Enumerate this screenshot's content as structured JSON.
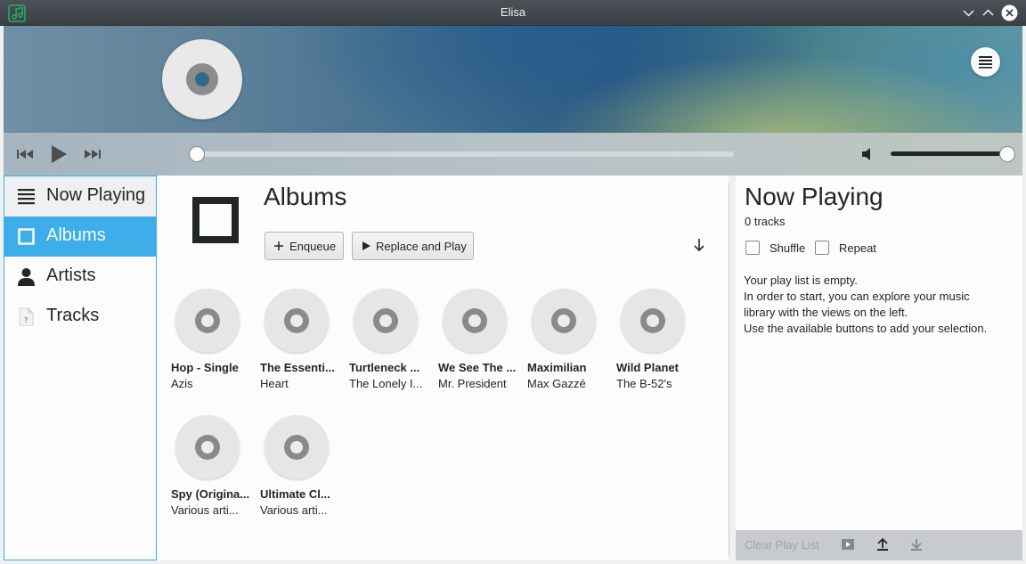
{
  "window": {
    "title": "Elisa"
  },
  "sidebar": {
    "items": [
      {
        "label": "Now Playing"
      },
      {
        "label": "Albums"
      },
      {
        "label": "Artists"
      },
      {
        "label": "Tracks"
      }
    ]
  },
  "main": {
    "title": "Albums",
    "enqueue_label": "Enqueue",
    "replace_play_label": "Replace and Play",
    "albums": [
      {
        "title": "Hop - Single",
        "artist": "Azis"
      },
      {
        "title": "The Essenti...",
        "artist": "Heart"
      },
      {
        "title": "Turtleneck ...",
        "artist": "The Lonely I..."
      },
      {
        "title": "We See The ...",
        "artist": "Mr. President"
      },
      {
        "title": "Maximilian",
        "artist": "Max Gazzé"
      },
      {
        "title": "Wild Planet",
        "artist": "The B-52's"
      },
      {
        "title": "Spy (Origina...",
        "artist": "Various arti..."
      },
      {
        "title": "Ultimate Cl...",
        "artist": "Various arti..."
      }
    ]
  },
  "player": {
    "seek_progress": 0,
    "volume": 1.0
  },
  "playlist": {
    "title": "Now Playing",
    "count": "0 tracks",
    "shuffle_label": "Shuffle",
    "repeat_label": "Repeat",
    "shuffle_checked": false,
    "repeat_checked": false,
    "empty_message": [
      "Your play list is empty.",
      "In order to start, you can explore your music",
      "library with the views on the left.",
      "Use the available buttons to add your selection."
    ],
    "clear_label": "Clear Play List"
  },
  "colors": {
    "accent": "#3daee9",
    "titlebar": "#3b4045",
    "text": "#232627",
    "panel": "#fcfcfc"
  },
  "icons": {
    "app": "music-note-icon",
    "menu": "hamburger-icon",
    "prev": "skip-back-icon",
    "play": "play-icon",
    "next": "skip-forward-icon",
    "volume": "speaker-icon",
    "sort": "arrow-down-icon"
  }
}
